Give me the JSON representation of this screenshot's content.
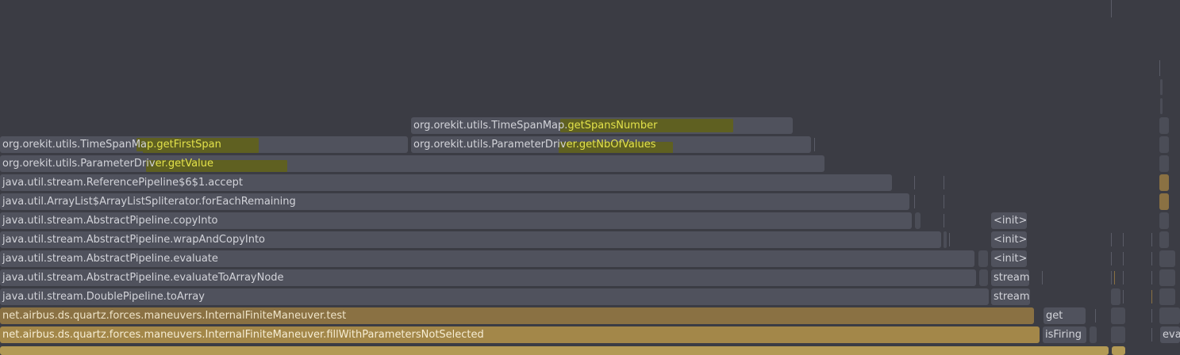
{
  "frames": [
    {
      "id": "f-spansnumber",
      "prefix": "org.orekit.utils.TimeSpanMap.",
      "match": "getSpansNumber"
    },
    {
      "id": "f-firstspan",
      "prefix": "org.orekit.utils.TimeSpanMa",
      "match": "p.getFirstSpan"
    },
    {
      "id": "f-nbofvalues",
      "prefix": "org.orekit.utils.ParameterDriv",
      "match": "er.getNbOfValues"
    },
    {
      "id": "f-getvalue",
      "prefix": "org.orekit.utils.ParameterDriv",
      "match": "er.getValue"
    },
    {
      "id": "f-accept",
      "text": "java.util.stream.ReferencePipeline$6$1.accept"
    },
    {
      "id": "f-foreach",
      "text": "java.util.ArrayList$ArrayListSpliterator.forEachRemaining"
    },
    {
      "id": "f-copyinto",
      "text": "java.util.stream.AbstractPipeline.copyInto"
    },
    {
      "id": "f-init-1",
      "text": "<init>"
    },
    {
      "id": "f-wrapandcopy",
      "text": "java.util.stream.AbstractPipeline.wrapAndCopyInto"
    },
    {
      "id": "f-init-2",
      "text": "<init>"
    },
    {
      "id": "f-evaluate",
      "text": "java.util.stream.AbstractPipeline.evaluate"
    },
    {
      "id": "f-init-3",
      "text": "<init>"
    },
    {
      "id": "f-toarraynode",
      "text": "java.util.stream.AbstractPipeline.evaluateToArrayNode"
    },
    {
      "id": "f-stream-1",
      "text": "stream"
    },
    {
      "id": "f-toarray",
      "text": "java.util.stream.DoublePipeline.toArray"
    },
    {
      "id": "f-stream-2",
      "text": "stream"
    },
    {
      "id": "f-test",
      "text": "net.airbus.ds.quartz.forces.maneuvers.InternalFiniteManeuver.test"
    },
    {
      "id": "f-get",
      "text": "get"
    },
    {
      "id": "f-fillwith",
      "text": "net.airbus.ds.quartz.forces.maneuvers.InternalFiniteManeuver.fillWithParametersNotSelected"
    },
    {
      "id": "f-isfiring",
      "text": "isFiring"
    },
    {
      "id": "f-eva",
      "text": "eva"
    }
  ],
  "colors": {
    "background": "#3b3c44",
    "frame": "#50525d",
    "frame_text": "#d2d3d9",
    "hot_frame": "#8a7143",
    "hotter_frame": "#a38749",
    "search_match_text": "#e3e24a",
    "search_match_bg": "#5f6021"
  }
}
